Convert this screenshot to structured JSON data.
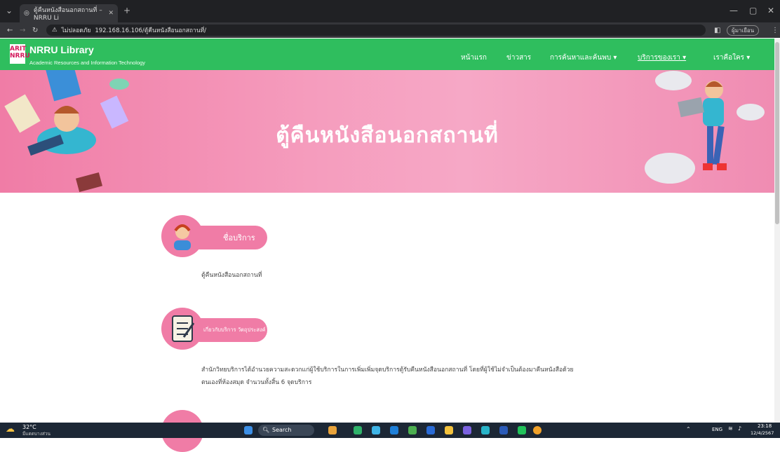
{
  "browser": {
    "tab_title": "ตู้คืนหนังสือนอกสถานที่ – NRRU Li",
    "new_tab": "+",
    "security": "ไม่ปลอดภัย",
    "url": "192.168.16.106/ตู้คืนหนังสือนอกสถานที่/",
    "profile": "ผู้มาเยือน"
  },
  "site": {
    "logo_text": "ARIT NRRU",
    "brand": "NRRU Library",
    "brand_sub": "Academic Resources and Information Technology",
    "menu": [
      {
        "label": "หน้าแรก"
      },
      {
        "label": "ข่าวสาร"
      },
      {
        "label": "การค้นหาและค้นพบ ▾"
      },
      {
        "label": "บริการของเรา ▾"
      },
      {
        "label": "เราคือใคร ▾"
      }
    ]
  },
  "hero": {
    "title": "ตู้คืนหนังสือนอกสถานที่"
  },
  "sections": [
    {
      "heading": "ชื่อบริการ",
      "text": "ตู้คืนหนังสือนอกสถานที่"
    },
    {
      "heading": "เกี่ยวกับบริการ วัตถุประสงค์",
      "text": "สำนักวิทยบริการได้อำนวยความสะดวกแก่ผู้ใช้บริการในการเพิ่มเพิ่มจุดบริการตู้รับคืนหนังสือนอกสถานที่ โดยที่ผู้ใช้ไม่จำเป็นต้องมาคืนหนังสือด้วย",
      "text2": "ตนเองที่ห้องสมุด จำนวนทั้งสิ้น 6 จุดบริการ"
    }
  ],
  "taskbar": {
    "weather_temp": "32°C",
    "weather_desc": "มีแดดบางส่วน",
    "search": "Search",
    "lang": "ENG",
    "time": "23:18",
    "date": "12/4/2567"
  },
  "colors": {
    "nav": "#2fbe5e",
    "accent": "#f07ca6"
  }
}
